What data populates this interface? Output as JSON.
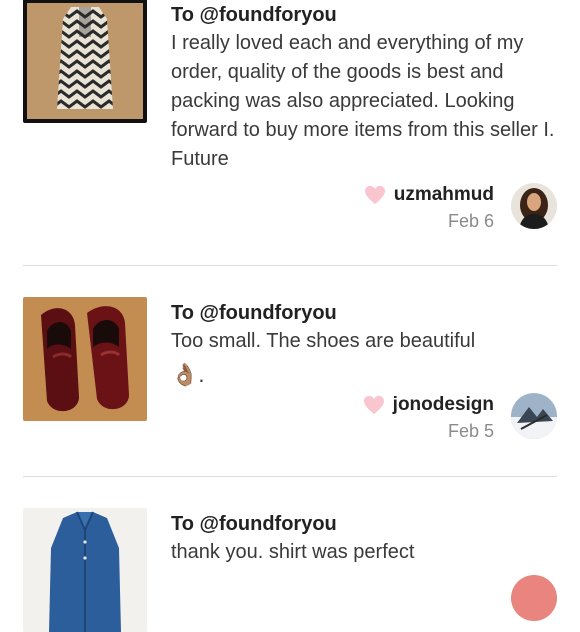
{
  "reviews": [
    {
      "to": "To @foundforyou",
      "text": "I really loved each and everything of my order, quality of the goods is best and packing was also appreciated. Looking forward to buy more items from this seller I. Future",
      "emoji": "",
      "username": "uzmahmud",
      "date": "Feb 6",
      "thumb_icon": "striped-dress-image",
      "avatar_icon": "user-avatar"
    },
    {
      "to": "To @foundforyou",
      "text": "Too small. The shoes are beautiful",
      "emoji": "👌🏽.",
      "username": "jonodesign",
      "date": "Feb 5",
      "thumb_icon": "burgundy-loafers-image",
      "avatar_icon": "user-avatar"
    },
    {
      "to": "To @foundforyou",
      "text": "thank you. shirt was perfect",
      "emoji": "",
      "username": "",
      "date": "",
      "thumb_icon": "blue-shirt-image",
      "avatar_icon": "user-avatar"
    }
  ],
  "colors": {
    "heart": "#f9c5ce",
    "divider": "#dddddd"
  }
}
